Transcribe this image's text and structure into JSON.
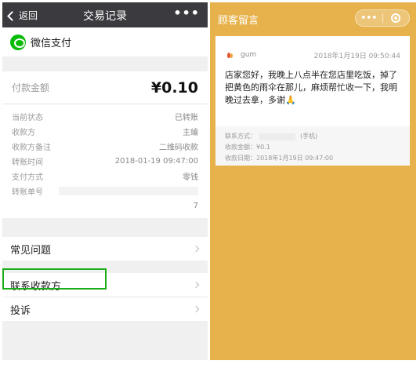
{
  "left": {
    "nav": {
      "back_label": "返回",
      "title": "交易记录",
      "more": "•••"
    },
    "payment_provider": "微信支付",
    "amount_label": "付款金额",
    "amount_value": "¥0.10",
    "details": [
      {
        "label": "当前状态",
        "value": "已转账"
      },
      {
        "label": "收款方",
        "value": "主编"
      },
      {
        "label": "收款方备注",
        "value": "二维码收款"
      },
      {
        "label": "转账时间",
        "value": "2018-01-19 09:47:00"
      },
      {
        "label": "支付方式",
        "value": "零钱"
      },
      {
        "label": "转账单号",
        "value": ""
      }
    ],
    "transfer_no_tail": "7",
    "menu": {
      "faq": "常见问题",
      "contact_payee": "联系收款方",
      "complain": "投诉"
    },
    "colors": {
      "nav_bg": "#3a3a3f",
      "wechat_green": "#09bb07",
      "highlight": "#1aad19"
    }
  },
  "right": {
    "nav": {
      "title": "顾客留言",
      "more": "•••"
    },
    "message": {
      "user": "gum",
      "time": "2018年1月19日 09:50:44",
      "text": "店家您好，我晚上八点半在您店里吃饭，掉了把黄色的雨伞在那儿，麻烦帮忙收一下，我明晚过去拿，多谢🙏",
      "contact_label": "联系方式：",
      "contact_suffix": "(手机)",
      "amount_line": "收款金额：¥0.1",
      "date_line": "收款日期：2018年1月19日 09:47:00"
    },
    "colors": {
      "bg": "#e7b24b"
    }
  }
}
